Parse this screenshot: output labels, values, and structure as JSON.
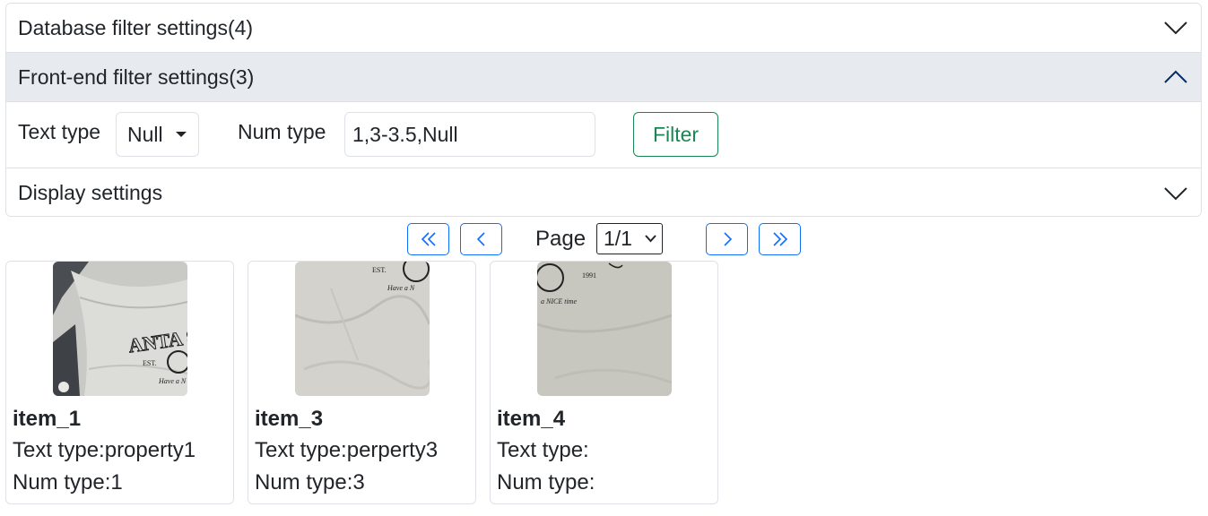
{
  "accordion": {
    "database_header": "Database filter settings(4)",
    "frontend_header": "Front-end filter settings(3)",
    "display_header": "Display settings"
  },
  "filters": {
    "text_type_label": "Text type",
    "text_type_value": "Null",
    "num_type_label": "Num type",
    "num_type_value": "1,3-3.5,Null",
    "filter_button": "Filter"
  },
  "pagination": {
    "page_label": "Page",
    "page_value": "1/1"
  },
  "items": [
    {
      "title": "item_1",
      "text_type": "Text type:property1",
      "num_type": "Num type:1",
      "image_texts": [
        "ANTA SPO",
        "EST.",
        "Have a N"
      ]
    },
    {
      "title": "item_3",
      "text_type": "Text type:perperty3",
      "num_type": "Num type:3",
      "image_texts": [
        "EST.",
        "Have a N"
      ]
    },
    {
      "title": "item_4",
      "text_type": "Text type:",
      "num_type": "Num type:",
      "image_texts": [
        "1991",
        "a NICE time"
      ]
    }
  ],
  "colors": {
    "accent_blue": "#0d6efd",
    "success_green": "#198754",
    "open_header_bg": "#e7eaee",
    "border": "#dee2e6"
  },
  "icons": {
    "collapsed": "chevron-down-icon",
    "expanded": "chevron-up-icon",
    "first": "chevron-double-left-icon",
    "prev": "chevron-left-icon",
    "next": "chevron-right-icon",
    "last": "chevron-double-right-icon"
  }
}
